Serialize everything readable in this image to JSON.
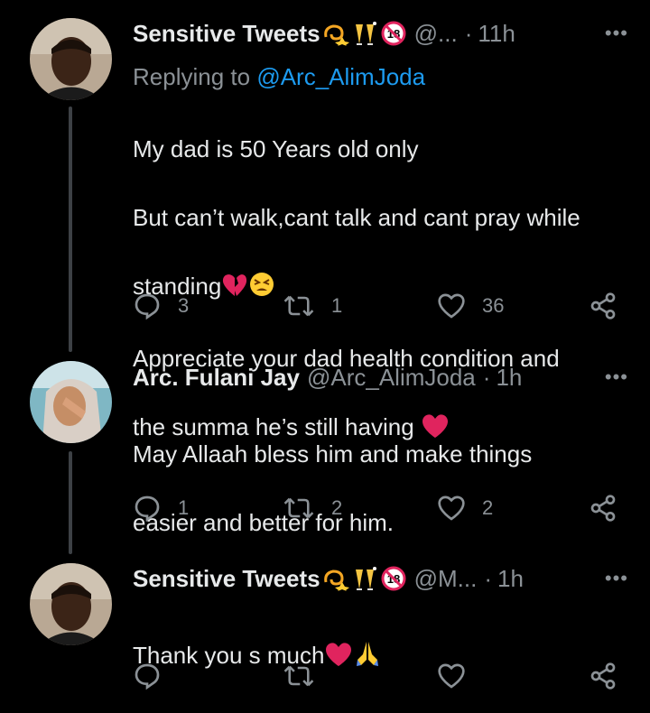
{
  "tweets": [
    {
      "name": "Sensitive Tweets",
      "handle": "@...",
      "time": "11h",
      "more": "•••",
      "replying_prefix": "Replying to ",
      "replying_handle": "@Arc_AlimJoda",
      "lines": [
        "My dad is 50 Years old only",
        "But can’t walk,cant talk and cant pray while",
        "standing",
        "Appreciate your dad health condition and",
        "the summa he’s still having"
      ],
      "replies": "3",
      "retweets": "1",
      "likes": "36"
    },
    {
      "name": "Arc. Fulani Jay",
      "handle": "@Arc_AlimJoda",
      "time": "1h",
      "more": "•••",
      "lines": [
        "May Allaah bless him and make things",
        "easier and better for him."
      ],
      "replies": "1",
      "retweets": "2",
      "likes": "2"
    },
    {
      "name": "Sensitive Tweets",
      "handle": "@M...",
      "time": "1h",
      "more": "•••",
      "lines": [
        "Thank you s much"
      ],
      "replies": "",
      "retweets": "",
      "likes": ""
    }
  ],
  "colors": {
    "background": "#000000",
    "text": "#e7e9ea",
    "muted": "#8b9196",
    "link": "#1d9bf0",
    "heart": "#e0245e"
  }
}
